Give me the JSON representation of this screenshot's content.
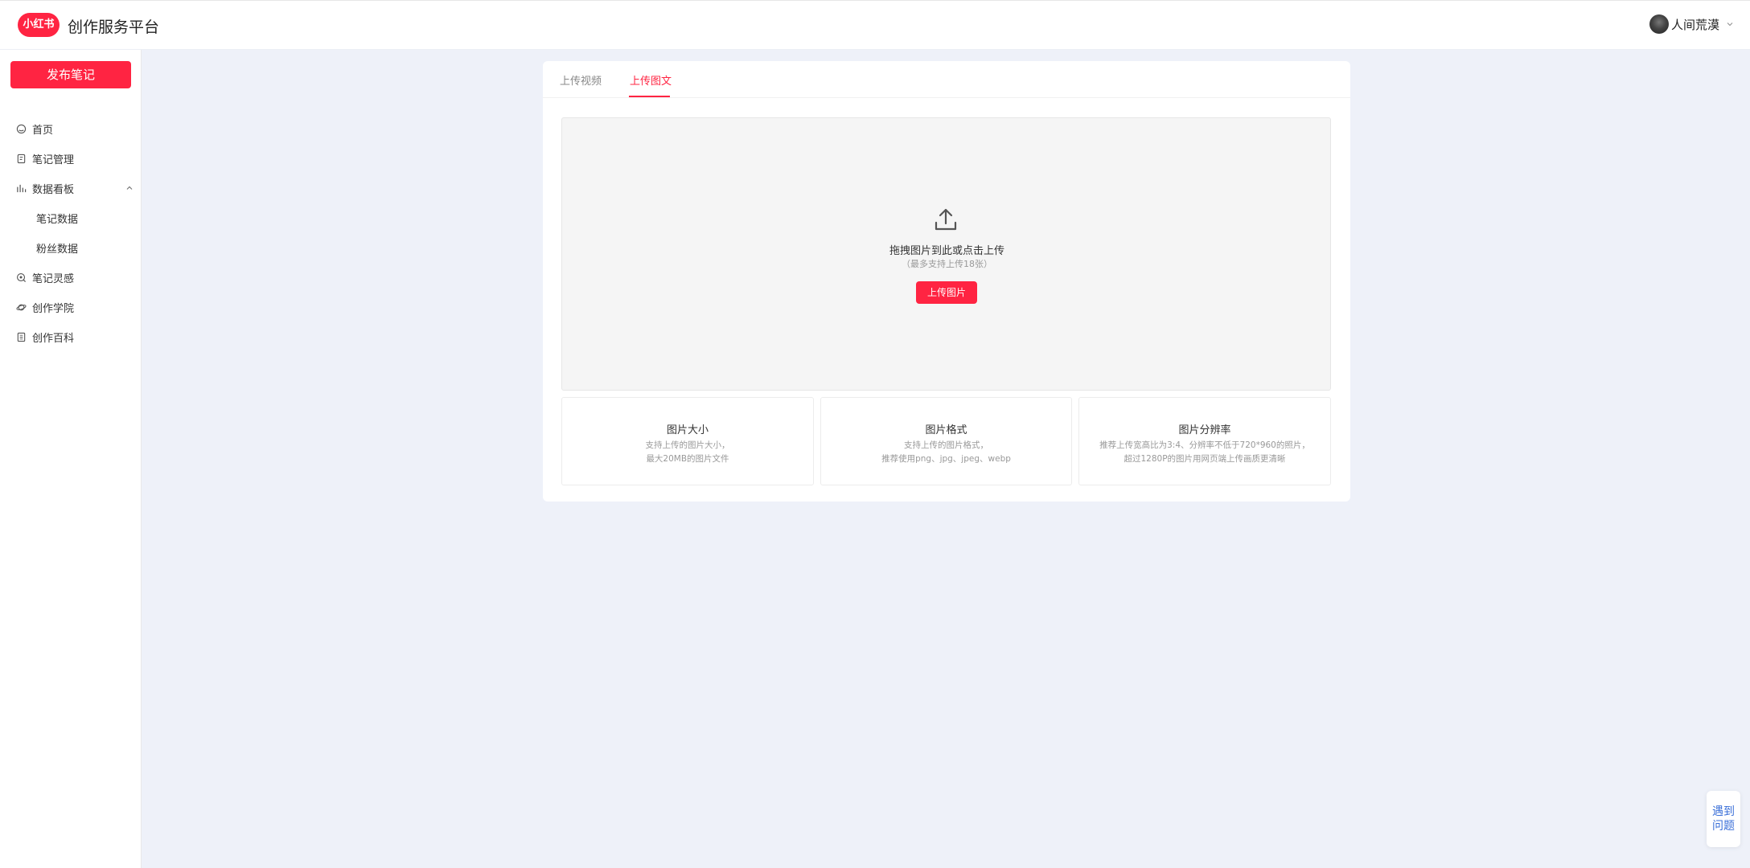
{
  "header": {
    "logo_text": "小红书",
    "platform_title": "创作服务平台",
    "username": "人间荒漠"
  },
  "sidebar": {
    "publish_label": "发布笔记",
    "items": [
      {
        "label": "首页",
        "icon": "home-icon"
      },
      {
        "label": "笔记管理",
        "icon": "note-icon"
      },
      {
        "label": "数据看板",
        "icon": "bar-chart-icon",
        "expanded": true
      },
      {
        "label": "笔记数据",
        "icon": ""
      },
      {
        "label": "粉丝数据",
        "icon": ""
      },
      {
        "label": "笔记灵感",
        "icon": "inspiration-icon"
      },
      {
        "label": "创作学院",
        "icon": "planet-icon"
      },
      {
        "label": "创作百科",
        "icon": "book-icon"
      }
    ]
  },
  "main": {
    "tabs": [
      {
        "label": "上传视频",
        "active": false
      },
      {
        "label": "上传图文",
        "active": true
      }
    ],
    "upload": {
      "hint": "拖拽图片到此或点击上传",
      "sub_hint": "（最多支持上传18张）",
      "button_label": "上传图片"
    },
    "info_boxes": [
      {
        "title": "图片大小",
        "lines": [
          "支持上传的图片大小，",
          "最大20MB的图片文件"
        ]
      },
      {
        "title": "图片格式",
        "lines": [
          "支持上传的图片格式，",
          "推荐使用png、jpg、jpeg、webp"
        ]
      },
      {
        "title": "图片分辨率",
        "lines": [
          "推荐上传宽高比为3:4、分辨率不低于720*960的照片，",
          "超过1280P的图片用网页端上传画质更清晰"
        ]
      }
    ]
  },
  "help": {
    "line1": "遇到",
    "line2": "问题"
  },
  "colors": {
    "accent": "#ff2442",
    "page_bg": "#eef1f9",
    "help_text": "#3a6fd8"
  }
}
